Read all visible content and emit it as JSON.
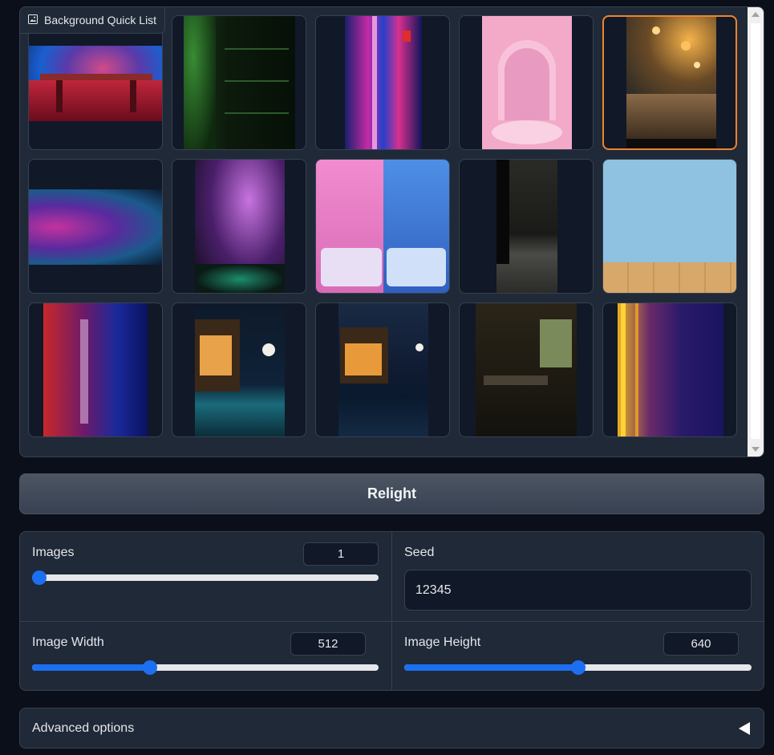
{
  "gallery": {
    "label": "Background Quick List",
    "icon": "image-icon",
    "thumbnails": [
      {
        "name": "red-table-blue-light"
      },
      {
        "name": "green-dungeon-shelves"
      },
      {
        "name": "neon-city-street"
      },
      {
        "name": "pink-arch-podium"
      },
      {
        "name": "bokeh-wooden-table",
        "selected": true
      },
      {
        "name": "purple-smoke-gradient"
      },
      {
        "name": "spotlight-smoke-stage"
      },
      {
        "name": "pink-blue-bedroom"
      },
      {
        "name": "dark-concrete-room"
      },
      {
        "name": "blue-wall-wood-floor"
      },
      {
        "name": "neon-skyscraper-street"
      },
      {
        "name": "villa-pool-moon"
      },
      {
        "name": "gazebo-water-night"
      },
      {
        "name": "dark-restaurant"
      },
      {
        "name": "neon-city-aerial"
      }
    ]
  },
  "relight_button": "Relight",
  "settings": {
    "images": {
      "label": "Images",
      "value": "1",
      "fraction": 0.0
    },
    "seed": {
      "label": "Seed",
      "value": "12345"
    },
    "width": {
      "label": "Image Width",
      "value": "512",
      "fraction": 0.34
    },
    "height": {
      "label": "Image Height",
      "value": "640",
      "fraction": 0.5
    }
  },
  "advanced": {
    "label": "Advanced options"
  },
  "colors": {
    "accent": "#1d6ff2",
    "selected_border": "#f0832c",
    "panel": "#1f2937",
    "background": "#0b0f19"
  }
}
